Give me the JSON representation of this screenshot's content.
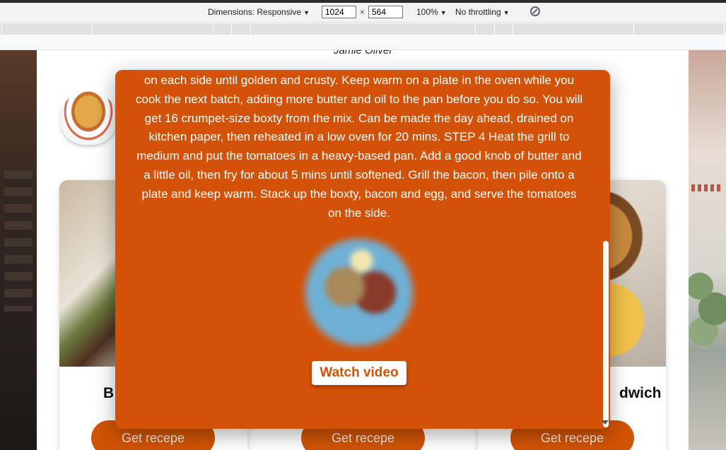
{
  "devtools": {
    "dimensions_label": "Dimensions: Responsive",
    "width_value": "1024",
    "times": "×",
    "height_value": "564",
    "zoom": "100%",
    "throttling": "No throttling"
  },
  "page": {
    "author": "Jamie Oliver",
    "cards": [
      {
        "title": "B",
        "button": "Get recepe"
      },
      {
        "title": "",
        "button": "Get recepe"
      },
      {
        "title": "dwich",
        "button": "Get recepe"
      }
    ]
  },
  "modal": {
    "instructions": "on each side until golden and crusty. Keep warm on a plate in the oven while you cook the next batch, adding more butter and oil to the pan before you do so. You will get 16 crumpet-size boxty from the mix. Can be made the day ahead, drained on kitchen paper, then reheated in a low oven for 20 mins. STEP 4 Heat the grill to medium and put the tomatoes in a heavy-based pan. Add a good knob of butter and a little oil, then fry for about 5 mins until softened. Grill the bacon, then pile onto a plate and keep warm. Stack up the boxty, bacon and egg, and serve the tomatoes on the side.",
    "watch_button": "Watch video"
  },
  "colors": {
    "accent": "#d15305",
    "modal_bg": "#d35208"
  }
}
